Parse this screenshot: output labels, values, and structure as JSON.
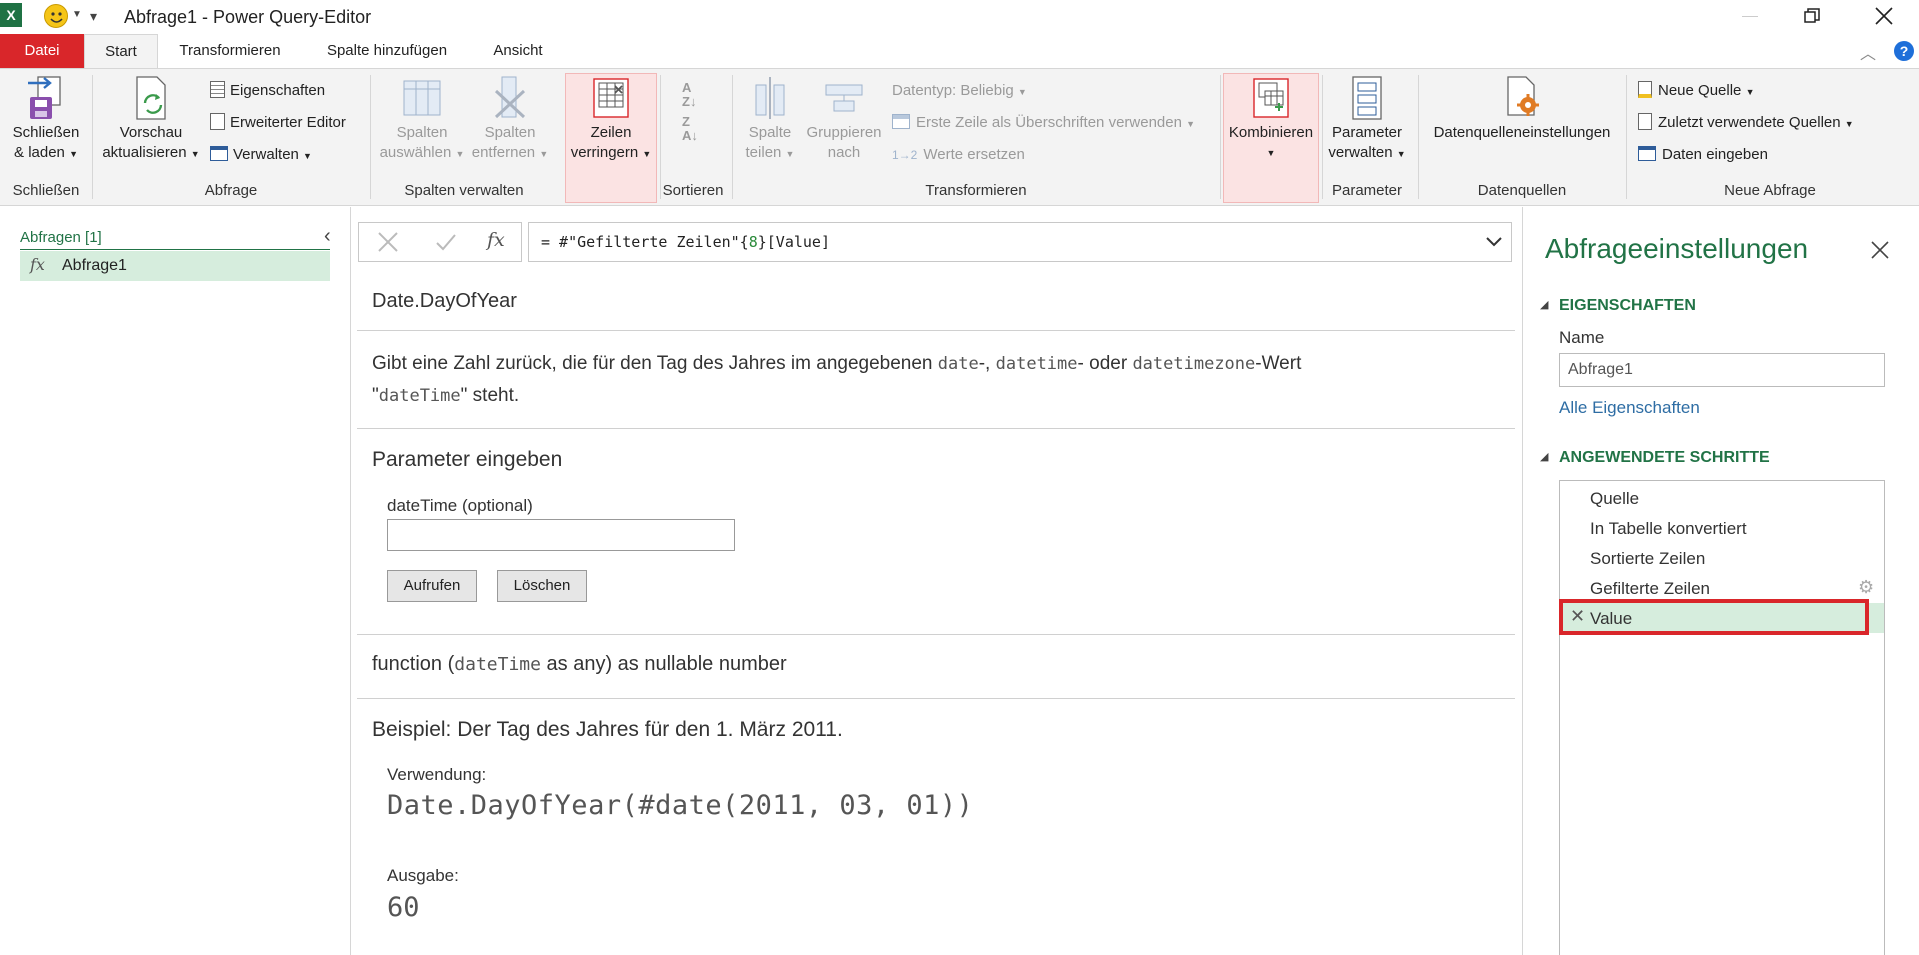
{
  "window": {
    "title": "Abfrage1 - Power Query-Editor",
    "quick_access_dropdown": "▾"
  },
  "tabs": {
    "file": "Datei",
    "start": "Start",
    "transform": "Transformieren",
    "add_column": "Spalte hinzufügen",
    "view": "Ansicht"
  },
  "ribbon": {
    "close_load": {
      "line1": "Schließen",
      "line2": "& laden",
      "group": "Schließen"
    },
    "query": {
      "refresh_line1": "Vorschau",
      "refresh_line2": "aktualisieren",
      "properties": "Eigenschaften",
      "advanced_editor": "Erweiterter Editor",
      "manage": "Verwalten",
      "group": "Abfrage"
    },
    "manage_columns": {
      "choose_line1": "Spalten",
      "choose_line2": "auswählen",
      "remove_line1": "Spalten",
      "remove_line2": "entfernen",
      "group": "Spalten verwalten"
    },
    "reduce_rows": {
      "line1": "Zeilen",
      "line2": "verringern"
    },
    "sort": {
      "group": "Sortieren"
    },
    "transform": {
      "split_line1": "Spalte",
      "split_line2": "teilen",
      "group_by_line1": "Gruppieren",
      "group_by_line2": "nach",
      "data_type": "Datentyp: Beliebig",
      "first_row_headers": "Erste Zeile als Überschriften verwenden",
      "replace_values": "Werte ersetzen",
      "group": "Transformieren"
    },
    "combine": {
      "line1": "Kombinieren"
    },
    "parameters": {
      "line1": "Parameter",
      "line2": "verwalten",
      "group": "Parameter"
    },
    "datasources": {
      "label": "Datenquelleneinstellungen",
      "group": "Datenquellen"
    },
    "new_query": {
      "new_source": "Neue Quelle",
      "recent_sources": "Zuletzt verwendete Quellen",
      "enter_data": "Daten eingeben",
      "group": "Neue Abfrage"
    }
  },
  "queries_pane": {
    "header": "Abfragen [1]",
    "items": [
      {
        "label": "Abfrage1",
        "icon": "fx"
      }
    ]
  },
  "formula_bar": {
    "prefix": "= #\"Gefilterte Zeilen\"{",
    "index": "8",
    "suffix": "}[Value]",
    "fx": "fx"
  },
  "function_doc": {
    "name": "Date.DayOfYear",
    "desc_1": "Gibt eine Zahl zurück, die für den Tag des Jahres im angegebenen ",
    "desc_code_1": "date",
    "desc_2": "-, ",
    "desc_code_2": "datetime",
    "desc_3": "- oder ",
    "desc_code_3": "datetimezone",
    "desc_4": "-Wert",
    "desc_5": "\"",
    "desc_code_4": "dateTime",
    "desc_6": "\" steht.",
    "params_title": "Parameter eingeben",
    "param_label": "dateTime (optional)",
    "param_value": "",
    "invoke_button": "Aufrufen",
    "clear_button": "Löschen",
    "signature_1": "function (",
    "signature_code": "dateTime",
    "signature_2": " as any) as nullable number",
    "example_title": "Beispiel: Der Tag des Jahres für den 1. März 2011.",
    "usage_label": "Verwendung:",
    "usage_code": "Date.DayOfYear(#date(2011, 03, 01))",
    "output_label": "Ausgabe:",
    "output_value": "60"
  },
  "settings_pane": {
    "title": "Abfrageeinstellungen",
    "properties_header": "EIGENSCHAFTEN",
    "name_label": "Name",
    "name_value": "Abfrage1",
    "all_properties": "Alle Eigenschaften",
    "steps_header": "ANGEWENDETE SCHRITTE",
    "steps": [
      {
        "label": "Quelle"
      },
      {
        "label": "In Tabelle konvertiert"
      },
      {
        "label": "Sortierte Zeilen"
      },
      {
        "label": "Gefilterte Zeilen"
      },
      {
        "label": "Value"
      }
    ]
  },
  "colors": {
    "accent_green": "#217346",
    "file_tab_red": "#d9262a",
    "selected_bg": "#d6eddd",
    "highlight_red": "#d9262a",
    "link_blue": "#2e6da4"
  }
}
